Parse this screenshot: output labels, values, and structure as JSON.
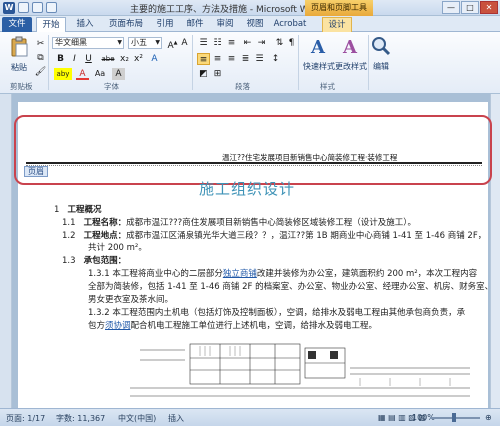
{
  "window": {
    "title": "主要的施工工序、方法及措施 - Microsoft Word",
    "context_tab_title": "页眉和页脚工具",
    "controls": [
      "—",
      "□",
      "✕"
    ]
  },
  "tabs": [
    "文件",
    "开始",
    "插入",
    "页面布局",
    "引用",
    "邮件",
    "审阅",
    "视图",
    "Acrobat",
    "设计"
  ],
  "ribbon": {
    "paste_label": "粘贴",
    "clipboard_group": "剪贴板",
    "font_name": "华文细黑",
    "font_size": "小五",
    "font_group": "字体",
    "paragraph_group": "段落",
    "styles_group": "样式",
    "quick_styles": "快速样式",
    "change_styles": "更改样式",
    "editing": "编辑",
    "format_buttons": [
      "B",
      "I",
      "U",
      "abe",
      "x₂",
      "x²",
      "A",
      "aby",
      "A",
      "Aa",
      "A"
    ]
  },
  "document": {
    "header_text": "温江??住宅发展项目新销售中心简装修工程·装修工程",
    "header_tag": "页眉",
    "title": "施工组织设计",
    "lines": [
      {
        "num": "1",
        "text": "工程概况"
      },
      {
        "num": "1.1",
        "label": "工程名称：",
        "text": "成都市温江???商住发展项目新销售中心简装修区域装修工程（设计及施工）。"
      },
      {
        "num": "1.2",
        "label": "工程地点：",
        "text": "成都市温江区涌泉镇光华大道三段？？，温江??第 1B 期商业中心商铺 1-41 至 1-46 商铺 2F，"
      },
      {
        "text": "共计 200 m²。"
      },
      {
        "num": "1.3",
        "label": "承包范围："
      },
      {
        "text_a": "1.3.1   本工程将商业中心的二层部分",
        "link": "独立商铺",
        "text_b": "改建并装修为办公室，建筑面积约 200 m²，本次工程内容"
      },
      {
        "text": "全部为简装修，包括 1-41 至 1-46 商铺 2F 的档案室、办公室、物业办公室、经理办公室、机房、财务室、"
      },
      {
        "text": "男女更衣室及茶水间。"
      },
      {
        "text": "1.3.2   本工程范围内土机电（包括灯饰及控制面板），空调，给排水及弱电工程由其他承包商负责，承"
      },
      {
        "text_a": "包方",
        "link": "须协调",
        "text_b": "配合机电工程施工单位进行上述机电，空调，给排水及弱电工程。"
      }
    ]
  },
  "status_bar": {
    "page": "页面: 1/17",
    "words": "字数: 11,367",
    "language": "中文(中国)",
    "mode": "插入",
    "zoom": "100%"
  }
}
